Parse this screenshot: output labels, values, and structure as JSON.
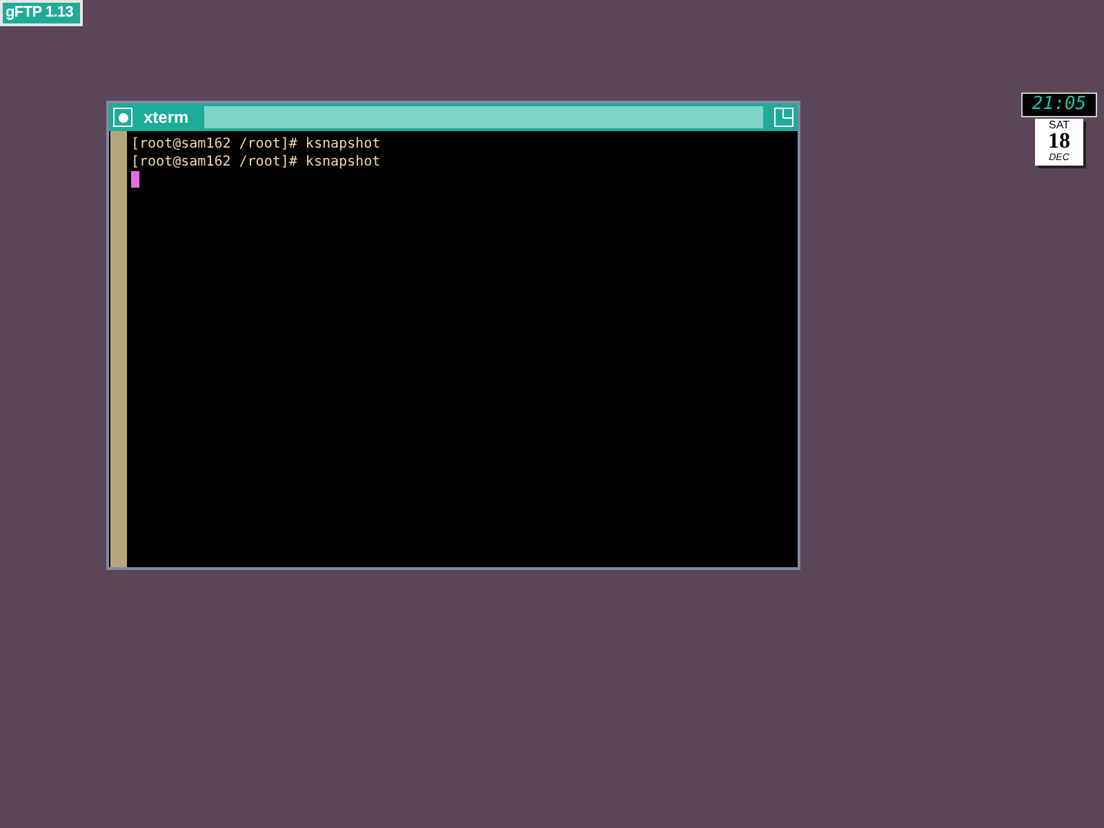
{
  "desktop_label": "gFTP 1.13",
  "window": {
    "title": "xterm",
    "lines": [
      "[root@sam162 /root]# ksnapshot",
      "[root@sam162 /root]# ksnapshot"
    ]
  },
  "clock": {
    "time": "21:05"
  },
  "calendar": {
    "weekday": "SAT",
    "day": "18",
    "month": "DEC"
  }
}
